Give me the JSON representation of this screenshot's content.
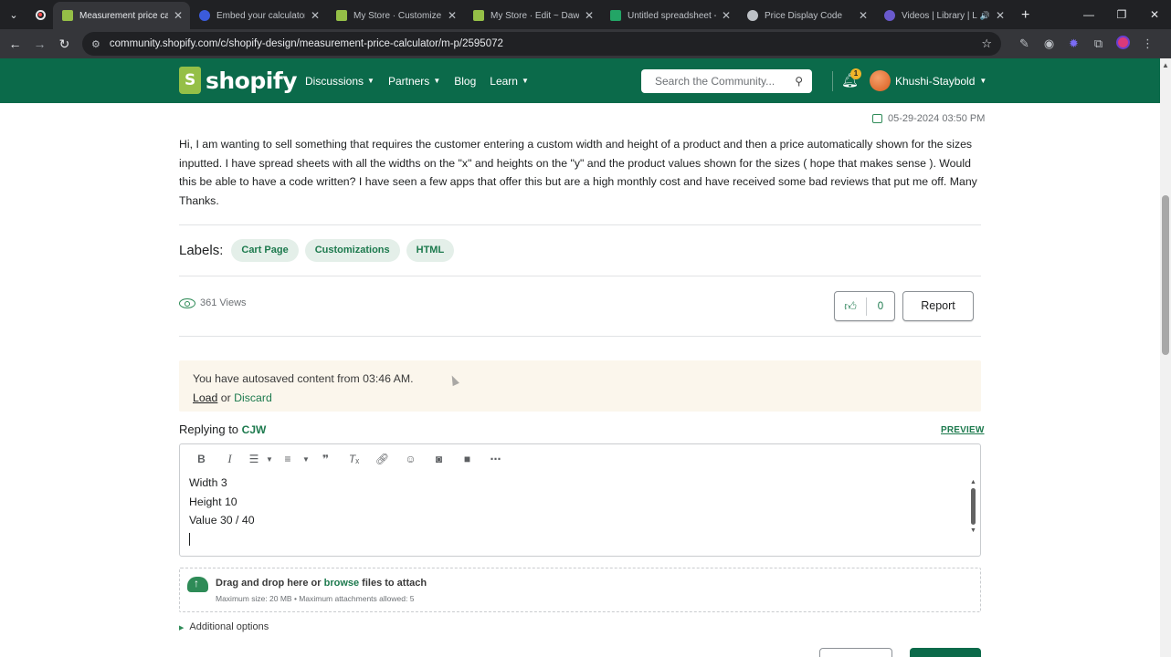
{
  "browser": {
    "tabs": [
      {
        "title": "Measurement price calcu",
        "favicon_color": "#95bf47",
        "active": true
      },
      {
        "title": "Embed your calculator -",
        "favicon_color": "#3b5bdb"
      },
      {
        "title": "My Store · Customize D",
        "favicon_color": "#95bf47"
      },
      {
        "title": "My Store · Edit ~ Dawn",
        "favicon_color": "#95bf47"
      },
      {
        "title": "Untitled spreadsheet - G",
        "favicon_color": "#23a566"
      },
      {
        "title": "Price Display Code",
        "favicon_color": "#bdc1c6"
      },
      {
        "title": "Videos | Library | Lo",
        "favicon_color": "#6a5acd"
      }
    ],
    "url": "community.shopify.com/c/shopify-design/measurement-price-calculator/m-p/2595072"
  },
  "header": {
    "logo_text": "shopify",
    "nav": [
      "Discussions",
      "Partners",
      "Blog",
      "Learn"
    ],
    "search_placeholder": "Search the Community...",
    "notification_count": "1",
    "user_name": "Khushi-Staybold"
  },
  "post": {
    "date": "05-29-2024 03:50 PM",
    "body": "Hi, I am wanting to sell something that requires the customer entering a custom width and height of a product and then a price automatically shown for the sizes inputted. I have spread sheets with all the widths on the \"x\" and heights on the \"y\" and the product values shown for the sizes ( hope that makes sense ). Would this be able to have a code written? I have seen a few apps that offer this but are a high monthly cost and have received some bad reviews that put me off.  Many Thanks.",
    "labels_title": "Labels:",
    "labels": [
      "Cart Page",
      "Customizations",
      "HTML"
    ],
    "views": "361 Views",
    "likes": "0",
    "report_label": "Report"
  },
  "autosave": {
    "message": "You have autosaved content from 03:46 AM.",
    "load": "Load",
    "or": "or",
    "discard": "Discard"
  },
  "reply": {
    "prefix": "Replying to",
    "to": "CJW",
    "preview": "PREVIEW",
    "lines": [
      "Width 3",
      "Height 10",
      "Value 30 / 40"
    ]
  },
  "attach": {
    "prefix": "Drag and drop here or",
    "browse": "browse",
    "suffix": "files to attach",
    "limits": "Maximum size: 20 MB • Maximum attachments allowed: 5"
  },
  "additional_options": "Additional options"
}
